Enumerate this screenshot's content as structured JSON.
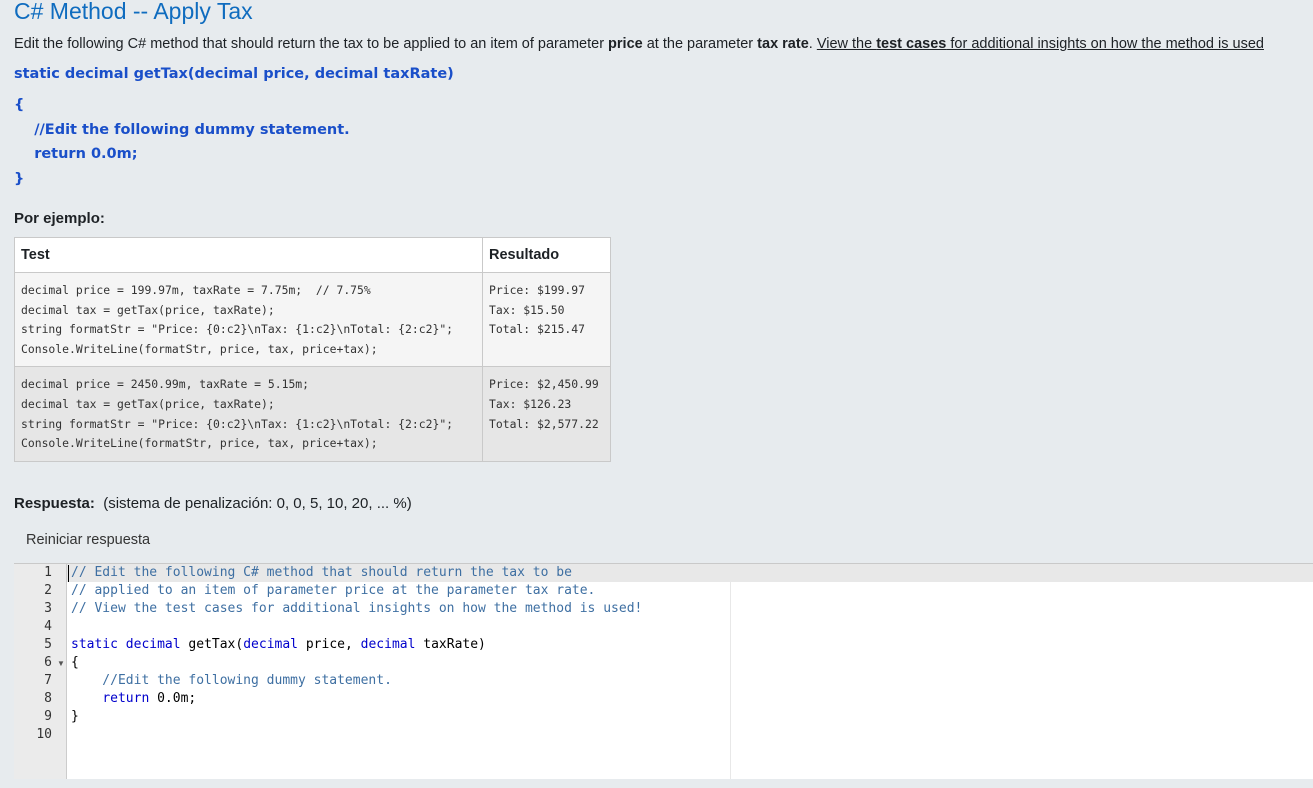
{
  "title": "C# Method -- Apply Tax",
  "description": {
    "part1": "Edit the following C# method that should return the tax to be applied to an item of parameter ",
    "bold1": "price",
    "part2": " at the parameter ",
    "bold2": "tax rate",
    "part3": ". ",
    "link_part1": "View the ",
    "link_bold": "test cases",
    "link_part2": " for additional insights on how the method is used"
  },
  "signature": "static decimal getTax(decimal price, decimal taxRate)",
  "body_lines": [
    "{",
    "    //Edit the following dummy statement.",
    "    return 0.0m;",
    "}"
  ],
  "example_label": "Por ejemplo:",
  "table": {
    "headers": [
      "Test",
      "Resultado"
    ],
    "rows": [
      {
        "test": "decimal price = 199.97m, taxRate = 7.75m;  // 7.75%\ndecimal tax = getTax(price, taxRate);\nstring formatStr = \"Price: {0:c2}\\nTax: {1:c2}\\nTotal: {2:c2}\";\nConsole.WriteLine(formatStr, price, tax, price+tax);",
        "result": "Price: $199.97\nTax: $15.50\nTotal: $215.47"
      },
      {
        "test": "decimal price = 2450.99m, taxRate = 5.15m;\ndecimal tax = getTax(price, taxRate);\nstring formatStr = \"Price: {0:c2}\\nTax: {1:c2}\\nTotal: {2:c2}\";\nConsole.WriteLine(formatStr, price, tax, price+tax);",
        "result": "Price: $2,450.99\nTax: $126.23\nTotal: $2,577.22"
      }
    ]
  },
  "answer": {
    "label": "Respuesta:",
    "penalty": "(sistema de penalización: 0, 0, 5, 10, 20, ... %)",
    "reset_label": "Reiniciar respuesta"
  },
  "editor": {
    "line_numbers": [
      "1",
      "2",
      "3",
      "4",
      "5",
      "6",
      "7",
      "8",
      "9",
      "10"
    ],
    "lines": [
      "// Edit the following C# method that should return the tax to be",
      "// applied to an item of parameter price at the parameter tax rate.",
      "// View the test cases for additional insights on how the method is used!",
      "",
      "static decimal getTax(decimal price, decimal taxRate)",
      "{",
      "    //Edit the following dummy statement.",
      "    return 0.0m;",
      "}",
      ""
    ]
  }
}
